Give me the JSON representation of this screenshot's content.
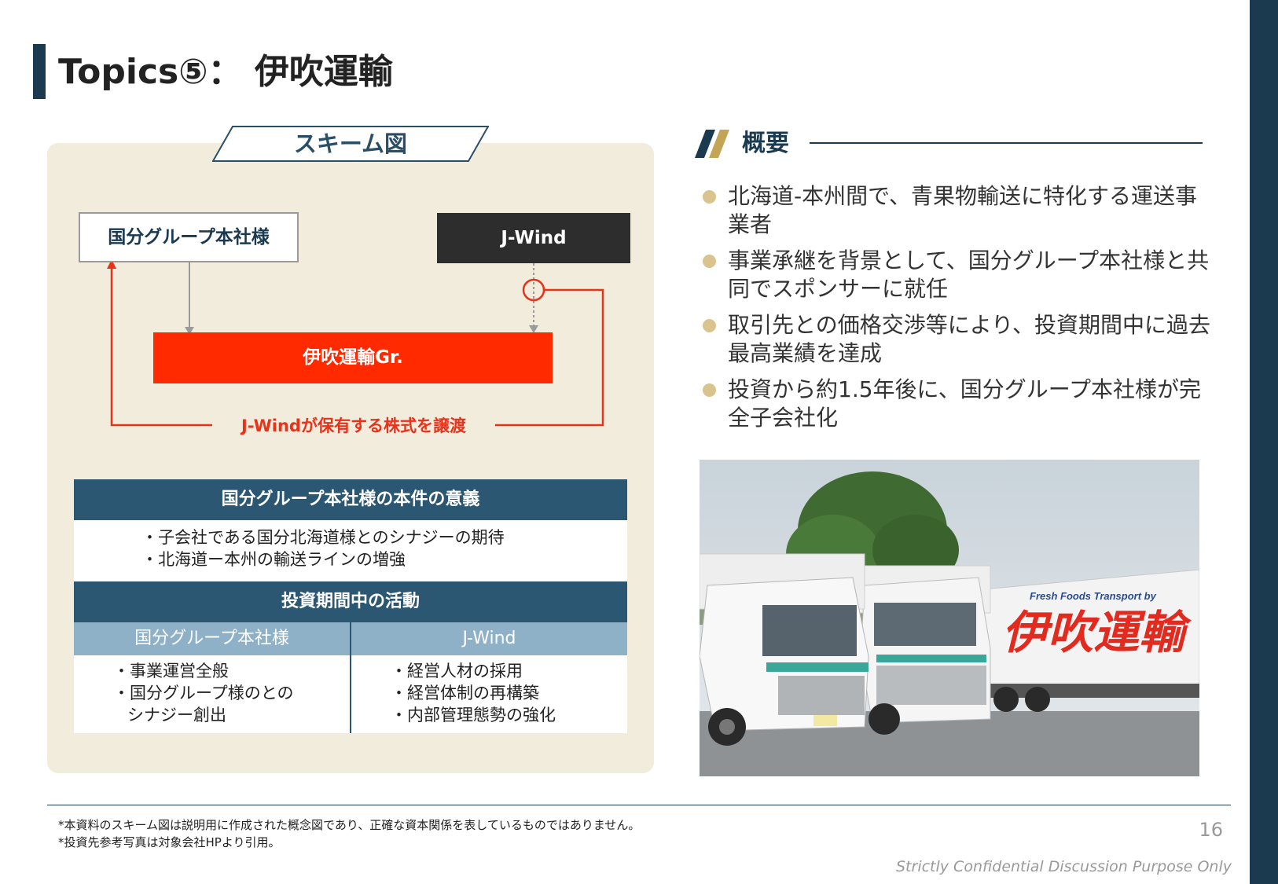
{
  "title": "Topics⑤： 伊吹運輸",
  "scheme": {
    "tab_label": "スキーム図",
    "kokubu_box": "国分グループ本社様",
    "jwind_box": "J-Wind",
    "ibuki_box": "伊吹運輸Gr.",
    "transfer_label": "J-Windが保有する株式を譲渡"
  },
  "table": {
    "significance_header": "国分グループ本社様の本件の意義",
    "significance_items": [
      "・子会社である国分北海道様とのシナジーの期待",
      "・北海道ー本州の輸送ラインの増強"
    ],
    "activities_header": "投資期間中の活動",
    "left_sub": "国分グループ本社様",
    "right_sub": "J-Wind",
    "left_items": [
      "・事業運営全般",
      "・国分グループ様のとの",
      "シナジー創出"
    ],
    "right_items": [
      "・経営人材の採用",
      "・経営体制の再構築",
      "・内部管理態勢の強化"
    ]
  },
  "overview": {
    "title": "概要",
    "bullets": [
      "北海道-本州間で、青果物輸送に特化する運送事業者",
      "事業承継を背景として、国分グループ本社様と共同でスポンサーに就任",
      "取引先との価格交渉等により、投資期間中に過去最高業績を達成",
      "投資から約1.5年後に、国分グループ本社様が完全子会社化"
    ]
  },
  "photo": {
    "truck_small_text": "Fresh Foods  Transport by",
    "truck_brand": "伊吹運輸"
  },
  "footer": {
    "note1": "*本資料のスキーム図は説明用に作成された概念図であり、正確な資本関係を表しているものではありません。",
    "note2": "*投資先参考写真は対象会社HPより引用。",
    "page_number": "16",
    "confidential": "Strictly Confidential Discussion Purpose Only"
  },
  "colors": {
    "navy": "#1b3a4f",
    "accent_red": "#ff2a00",
    "panel_beige": "#f2ecdd",
    "table_header": "#2c5773",
    "table_sub": "#8fb1c7",
    "bullet_gold": "#d9c48e"
  }
}
